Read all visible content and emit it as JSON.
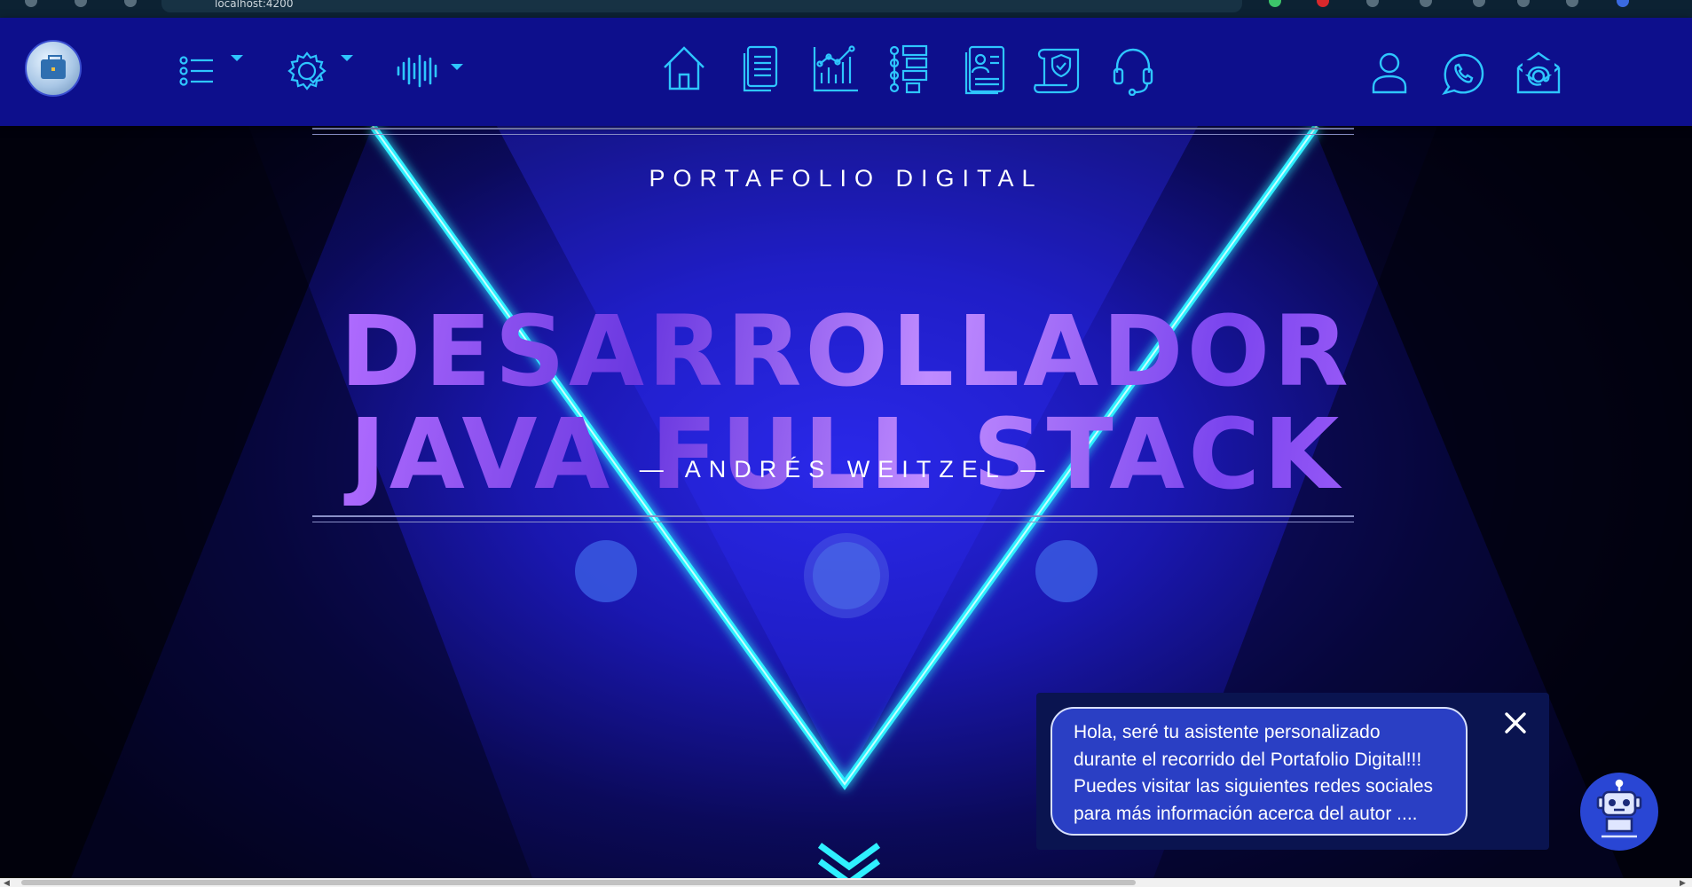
{
  "browser": {
    "url": "localhost:4200"
  },
  "nav": {
    "left": [
      {
        "name": "menu-list-icon"
      },
      {
        "name": "settings-check-icon"
      },
      {
        "name": "audio-wave-icon"
      }
    ],
    "center": [
      {
        "name": "home-icon"
      },
      {
        "name": "document-icon"
      },
      {
        "name": "chart-icon"
      },
      {
        "name": "tree-list-icon"
      },
      {
        "name": "resume-icon"
      },
      {
        "name": "certificate-icon"
      },
      {
        "name": "headset-icon"
      }
    ],
    "right": [
      {
        "name": "user-icon"
      },
      {
        "name": "whatsapp-icon"
      },
      {
        "name": "email-icon"
      }
    ],
    "accent_color": "#2ec6ff",
    "background_color": "#0d0f8c"
  },
  "hero": {
    "kicker": "PORTAFOLIO DIGITAL",
    "title_line1": "DESARROLLADOR",
    "title_line2": "JAVA FULL STACK",
    "author": "— ANDRÉS WEITZEL —",
    "neon_color": "#2ff0ff"
  },
  "chat": {
    "message": "Hola, seré tu asistente personalizado durante el recorrido del Portafolio Digital!!! Puedes visitar las siguientes redes sociales para más información acerca del autor ....",
    "close_icon": "close-icon",
    "bot_icon": "robot-icon"
  }
}
